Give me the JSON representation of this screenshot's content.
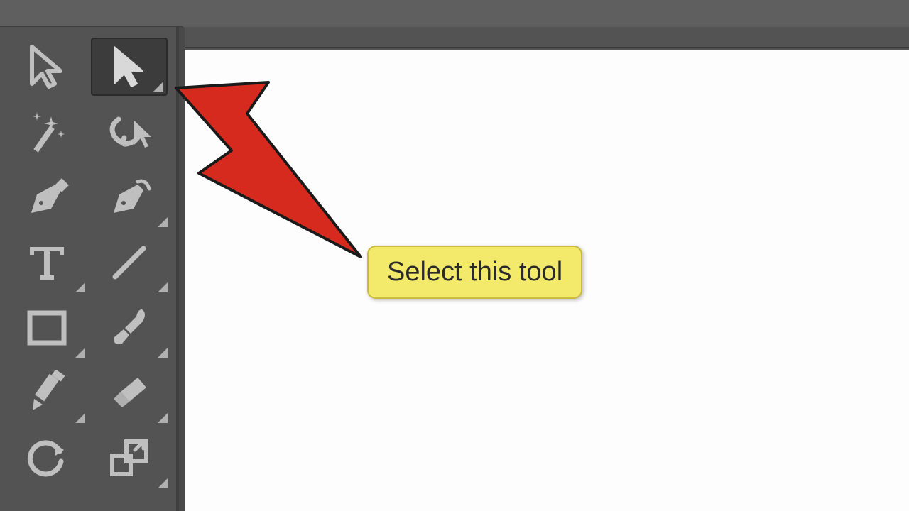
{
  "callout": {
    "text": "Select this tool"
  },
  "tools": {
    "selection": {
      "name": "selection-tool"
    },
    "direct_selection": {
      "name": "direct-selection-tool",
      "selected": true
    },
    "magic_wand": {
      "name": "magic-wand-tool"
    },
    "lasso": {
      "name": "lasso-tool"
    },
    "pen": {
      "name": "pen-tool"
    },
    "curvature": {
      "name": "curvature-tool"
    },
    "type": {
      "name": "type-tool"
    },
    "line": {
      "name": "line-segment-tool"
    },
    "rectangle": {
      "name": "rectangle-tool"
    },
    "paintbrush": {
      "name": "paintbrush-tool"
    },
    "pencil": {
      "name": "pencil-tool"
    },
    "eraser": {
      "name": "eraser-tool"
    },
    "rotate": {
      "name": "rotate-tool"
    },
    "scale": {
      "name": "scale-tool"
    }
  },
  "colors": {
    "icon": "#bfbfbf",
    "icon_selected": "#d8d8d8",
    "arrow_fill": "#d62a1f",
    "arrow_stroke": "#1a1a1a",
    "label_bg": "#f3e96b"
  }
}
